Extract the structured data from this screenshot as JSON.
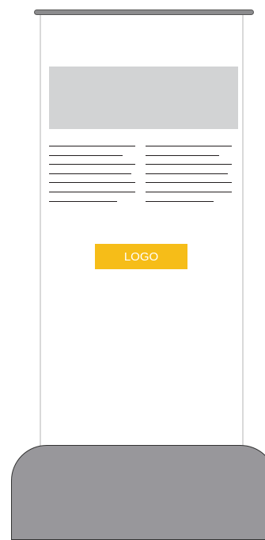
{
  "banner": {
    "logo_label": "LOGO",
    "text_columns": [
      {
        "lines": 7
      },
      {
        "lines": 7
      }
    ],
    "colors": {
      "logo_background": "#f6bd18",
      "logo_text": "#ffffff",
      "header_block": "#d2d3d4",
      "base": "#98979b",
      "top_bar": "#8c8c8e"
    }
  }
}
